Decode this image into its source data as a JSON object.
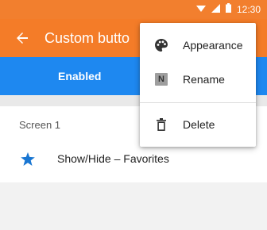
{
  "status_bar": {
    "time": "12:30",
    "icons": [
      "wifi-icon",
      "signal-icon",
      "battery-icon"
    ]
  },
  "app_bar": {
    "back_icon": "back-arrow-icon",
    "title": "Custom butto"
  },
  "enabled_bar": {
    "label": "Enabled"
  },
  "list": {
    "section_header": "Screen 1",
    "items": [
      {
        "icon": "star-icon",
        "label": "Show/Hide – Favorites"
      }
    ]
  },
  "menu": {
    "items": [
      {
        "icon": "palette-icon",
        "label": "Appearance"
      },
      {
        "icon": "rename-icon",
        "icon_text": "N",
        "label": "Rename"
      },
      {
        "icon": "trash-icon",
        "label": "Delete"
      }
    ]
  },
  "colors": {
    "status_bar": "#f27f2e",
    "app_bar": "#f47c28",
    "enabled_bar": "#1e88f0",
    "star": "#1976d2",
    "background": "#f2f2f2"
  }
}
